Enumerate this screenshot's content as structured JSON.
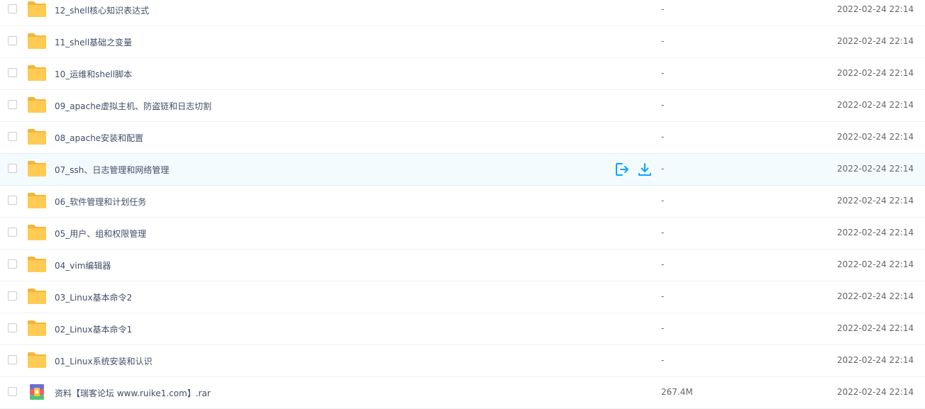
{
  "files": [
    {
      "name": "12_shell核心知识表达式",
      "size": "-",
      "modified": "2022-02-24 22:14",
      "type": "folder",
      "icon": "folder-icon"
    },
    {
      "name": "11_shell基础之变量",
      "size": "-",
      "modified": "2022-02-24 22:14",
      "type": "folder",
      "icon": "folder-icon"
    },
    {
      "name": "10_运维和shell脚本",
      "size": "-",
      "modified": "2022-02-24 22:14",
      "type": "folder",
      "icon": "folder-icon"
    },
    {
      "name": "09_apache虚拟主机、防盗链和日志切割",
      "size": "-",
      "modified": "2022-02-24 22:14",
      "type": "folder",
      "icon": "folder-icon"
    },
    {
      "name": "08_apache安装和配置",
      "size": "-",
      "modified": "2022-02-24 22:14",
      "type": "folder",
      "icon": "folder-icon"
    },
    {
      "name": "07_ssh、日志管理和网络管理",
      "size": "-",
      "modified": "2022-02-24 22:14",
      "type": "folder",
      "icon": "folder-icon",
      "hovered": true
    },
    {
      "name": "06_软件管理和计划任务",
      "size": "-",
      "modified": "2022-02-24 22:14",
      "type": "folder",
      "icon": "folder-icon"
    },
    {
      "name": "05_用户、组和权限管理",
      "size": "-",
      "modified": "2022-02-24 22:14",
      "type": "folder",
      "icon": "folder-icon"
    },
    {
      "name": "04_vim编辑器",
      "size": "-",
      "modified": "2022-02-24 22:14",
      "type": "folder",
      "icon": "folder-icon"
    },
    {
      "name": "03_Linux基本命令2",
      "size": "-",
      "modified": "2022-02-24 22:14",
      "type": "folder",
      "icon": "folder-icon"
    },
    {
      "name": "02_Linux基本命令1",
      "size": "-",
      "modified": "2022-02-24 22:14",
      "type": "folder",
      "icon": "folder-icon"
    },
    {
      "name": "01_Linux系统安装和认识",
      "size": "-",
      "modified": "2022-02-24 22:14",
      "type": "folder",
      "icon": "folder-icon"
    },
    {
      "name": "资料【瑞客论坛 www.ruike1.com】.rar",
      "size": "267.4M",
      "modified": "2022-02-24 22:14",
      "type": "rar",
      "icon": "rar-archive-icon"
    }
  ],
  "row_actions": {
    "share_icon": "share-out-icon",
    "download_icon": "download-icon"
  },
  "colors": {
    "folder": "#ffc74a",
    "accent": "#06a7ff",
    "hover_bg": "#f4fbff",
    "text": "#424e67",
    "meta_text": "#666666"
  }
}
